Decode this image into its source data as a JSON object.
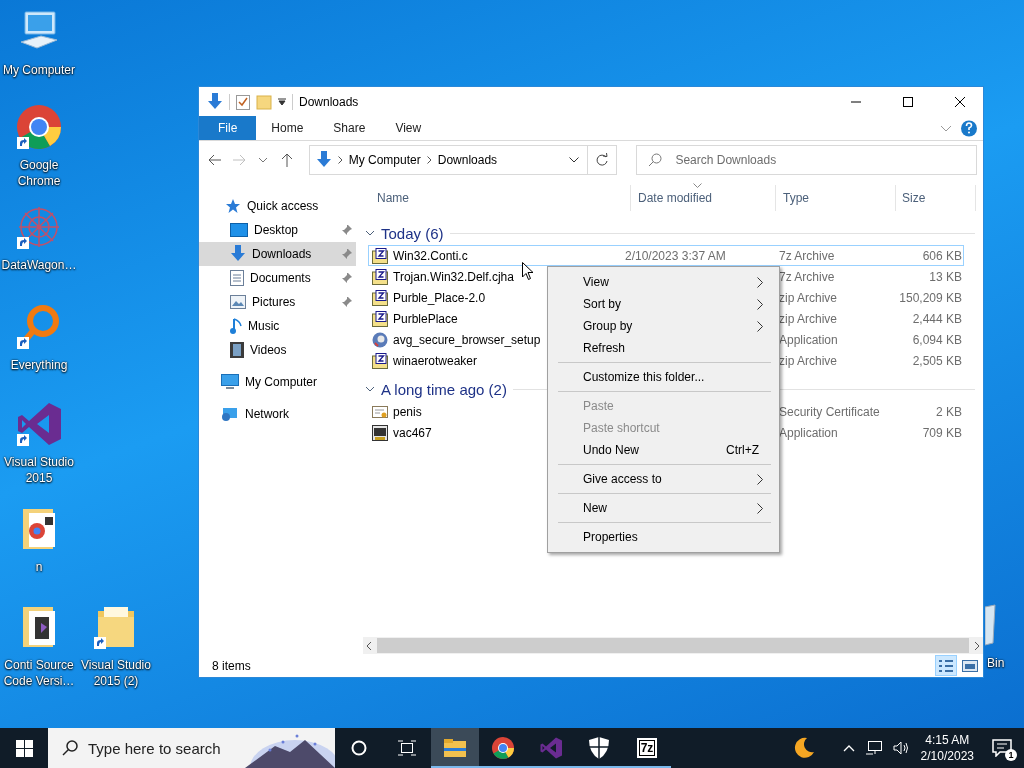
{
  "desktop": {
    "icons": [
      {
        "label": "My Computer",
        "kind": "computer",
        "shortcut": false
      },
      {
        "label": "Google Chrome",
        "kind": "chrome",
        "shortcut": true
      },
      {
        "label": "DataWagon…",
        "kind": "mandala",
        "shortcut": true
      },
      {
        "label": "Everything",
        "kind": "magnifier",
        "shortcut": true
      },
      {
        "label": "Visual Studio 2015",
        "kind": "vs",
        "shortcut": true
      },
      {
        "label": "n",
        "kind": "folder-chrome",
        "shortcut": false
      },
      {
        "label": "Conti Source Code Versi…",
        "kind": "folder-vs",
        "shortcut": false
      },
      {
        "label": "Visual Studio 2015 (2)",
        "kind": "folder",
        "shortcut": true
      },
      {
        "label": "Bin",
        "kind": "bin"
      }
    ]
  },
  "window": {
    "title": "Downloads",
    "ribbon_tabs": [
      {
        "label": "File",
        "kind": "menu"
      },
      {
        "label": "Home",
        "kind": "tab"
      },
      {
        "label": "Share",
        "kind": "tab"
      },
      {
        "label": "View",
        "kind": "tab"
      }
    ],
    "address": {
      "crumbs": [
        "My Computer",
        "Downloads"
      ]
    },
    "search": {
      "placeholder": "Search Downloads"
    },
    "nav_pane": {
      "items": [
        {
          "label": "Quick access",
          "kind": "star",
          "selected": false,
          "children": [
            {
              "label": "Desktop",
              "kind": "desktop",
              "selected": false,
              "pinned": true
            },
            {
              "label": "Downloads",
              "kind": "download",
              "selected": true,
              "pinned": true
            },
            {
              "label": "Documents",
              "kind": "document",
              "selected": false,
              "pinned": true
            },
            {
              "label": "Pictures",
              "kind": "pictures",
              "selected": false,
              "pinned": true
            },
            {
              "label": "Music",
              "kind": "music",
              "selected": false,
              "pinned": false
            },
            {
              "label": "Videos",
              "kind": "video",
              "selected": false,
              "pinned": false
            }
          ]
        },
        {
          "label": "My Computer",
          "kind": "computer",
          "selected": false
        },
        {
          "label": "Network",
          "kind": "network",
          "selected": false
        }
      ]
    },
    "columns": [
      {
        "label": "Name",
        "sorted": false
      },
      {
        "label": "Date modified",
        "sorted": true
      },
      {
        "label": "Type",
        "sorted": false
      },
      {
        "label": "Size",
        "sorted": false
      }
    ],
    "groups": [
      {
        "label": "Today (6)",
        "expanded": true,
        "files": [
          {
            "name": "Win32.Conti.c",
            "date": "2/10/2023 3:37 AM",
            "type": "7z Archive",
            "size": "606 KB",
            "kind": "archive",
            "selected": true
          },
          {
            "name": "Trojan.Win32.Delf.cjha",
            "type": "7z Archive",
            "size": "13 KB",
            "kind": "archive",
            "selected": false
          },
          {
            "name": "Purble_Place-2.0",
            "type": "zip Archive",
            "size": "150,209 KB",
            "kind": "archive",
            "selected": false
          },
          {
            "name": "PurblePlace",
            "type": "zip Archive",
            "size": "2,444 KB",
            "kind": "archive",
            "selected": false
          },
          {
            "name": "avg_secure_browser_setup",
            "type": "Application",
            "size": "6,094 KB",
            "kind": "globe",
            "selected": false
          },
          {
            "name": "winaerotweaker",
            "type": "zip Archive",
            "size": "2,505 KB",
            "kind": "archive",
            "selected": false
          }
        ]
      },
      {
        "label": "A long time ago (2)",
        "expanded": true,
        "files": [
          {
            "name": "penis",
            "type": "Security Certificate",
            "size": "2 KB",
            "kind": "certificate",
            "selected": false
          },
          {
            "name": "vac467",
            "type": "Application",
            "size": "709 KB",
            "kind": "app",
            "selected": false
          }
        ]
      }
    ],
    "status": "8 items",
    "views": [
      {
        "kind": "details",
        "selected": true
      },
      {
        "kind": "tiles",
        "selected": false
      }
    ]
  },
  "context_menu": {
    "items": [
      {
        "kind": "item",
        "label": "View",
        "submenu": true,
        "disabled": false
      },
      {
        "kind": "item",
        "label": "Sort by",
        "submenu": true,
        "disabled": false
      },
      {
        "kind": "item",
        "label": "Group by",
        "submenu": true,
        "disabled": false
      },
      {
        "kind": "item",
        "label": "Refresh",
        "submenu": false,
        "disabled": false
      },
      {
        "kind": "separator"
      },
      {
        "kind": "item",
        "label": "Customize this folder...",
        "submenu": false,
        "disabled": false
      },
      {
        "kind": "separator"
      },
      {
        "kind": "item",
        "label": "Paste",
        "submenu": false,
        "disabled": true
      },
      {
        "kind": "item",
        "label": "Paste shortcut",
        "submenu": false,
        "disabled": true
      },
      {
        "kind": "item",
        "label": "Undo New",
        "shortcut": "Ctrl+Z",
        "submenu": false,
        "disabled": false
      },
      {
        "kind": "separator"
      },
      {
        "kind": "item",
        "label": "Give access to",
        "submenu": true,
        "disabled": false
      },
      {
        "kind": "separator"
      },
      {
        "kind": "item",
        "label": "New",
        "submenu": true,
        "disabled": false
      },
      {
        "kind": "separator"
      },
      {
        "kind": "item",
        "label": "Properties",
        "submenu": false,
        "disabled": false
      }
    ]
  },
  "taskbar": {
    "search": {
      "placeholder": "Type here to search"
    },
    "apps": [
      {
        "kind": "explorer",
        "active": true,
        "running": true
      },
      {
        "kind": "chrome",
        "active": false,
        "running": true
      },
      {
        "kind": "vs",
        "active": false,
        "running": true
      },
      {
        "kind": "shield",
        "active": false,
        "running": true
      },
      {
        "kind": "sevenzip",
        "label": "7z",
        "active": false,
        "running": true
      }
    ],
    "time": "4:15 AM",
    "date": "2/10/2023",
    "notifications": "1"
  }
}
